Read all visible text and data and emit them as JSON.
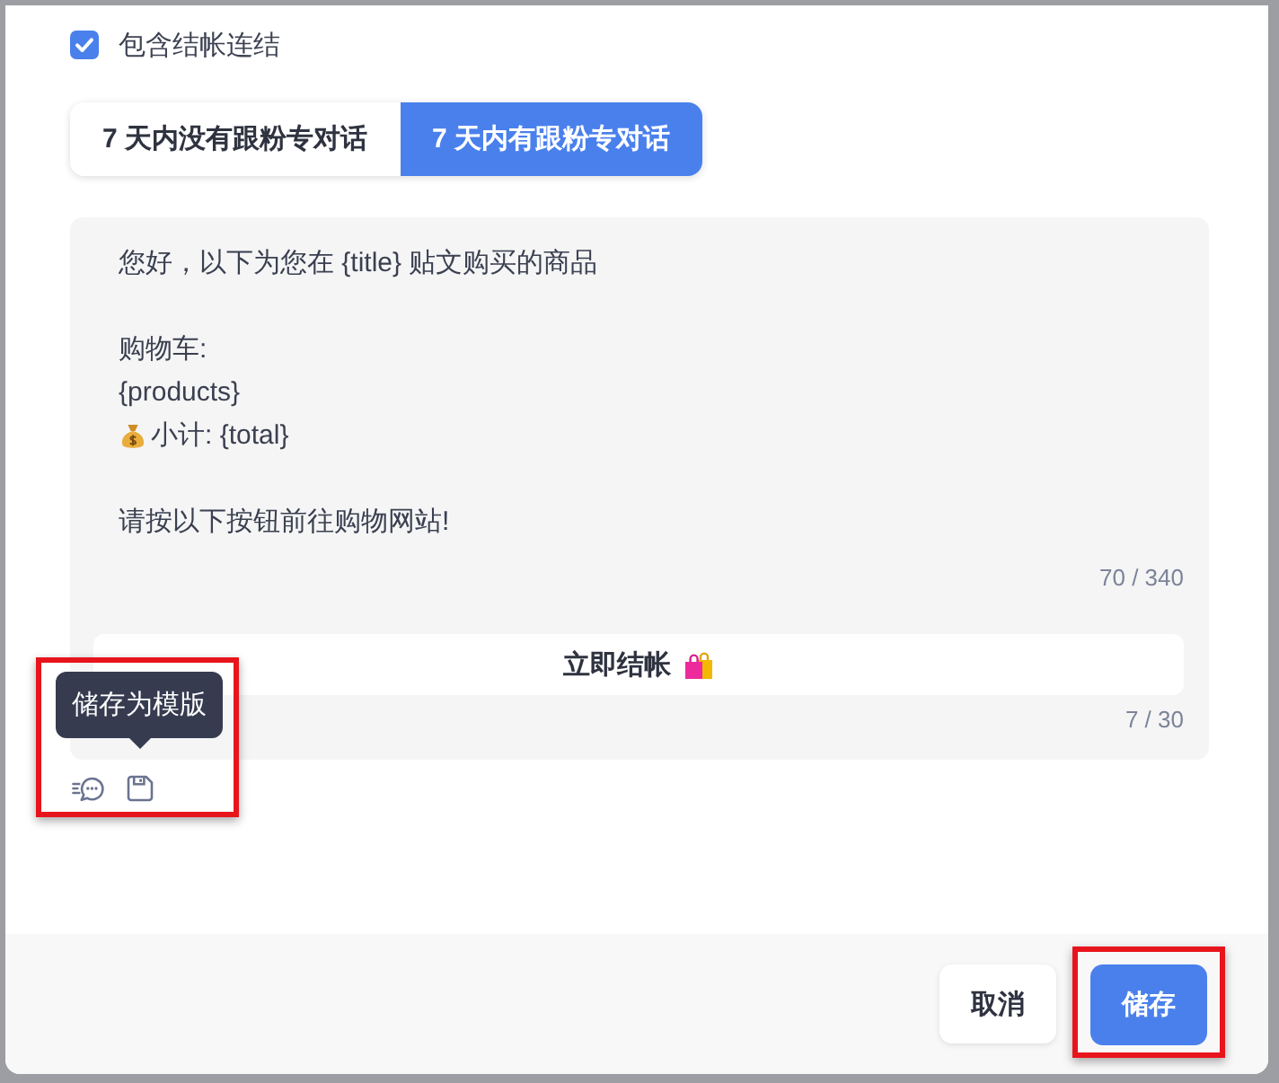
{
  "checkout_link": {
    "label": "包含结帐连结",
    "checked": true
  },
  "tabs": [
    {
      "label": "7 天内没有跟粉专对话",
      "selected": false
    },
    {
      "label": "7 天内有跟粉专对话",
      "selected": true
    }
  ],
  "message": {
    "paragraphs": [
      [
        {
          "kind": "plain",
          "text": "您好，以下为您在 {title} 贴文购买的商品"
        }
      ],
      [
        {
          "kind": "plain",
          "text": "购物车:"
        },
        {
          "kind": "plain",
          "text": "{products}"
        },
        {
          "kind": "money",
          "text": "小计: {total}"
        }
      ],
      [
        {
          "kind": "plain",
          "text": "请按以下按钮前往购物网站!"
        }
      ]
    ],
    "counter": "70 / 340"
  },
  "button_label_field": {
    "value": "立即结帐",
    "shopping_icon": true,
    "counter": "7 / 30"
  },
  "template_actions": {
    "tooltip": "储存为模版",
    "highlighted": true
  },
  "footer": {
    "buttons": [
      {
        "label": "取消",
        "kind": "secondary",
        "highlighted": false
      },
      {
        "label": "储存",
        "kind": "primary",
        "highlighted": true
      }
    ]
  }
}
